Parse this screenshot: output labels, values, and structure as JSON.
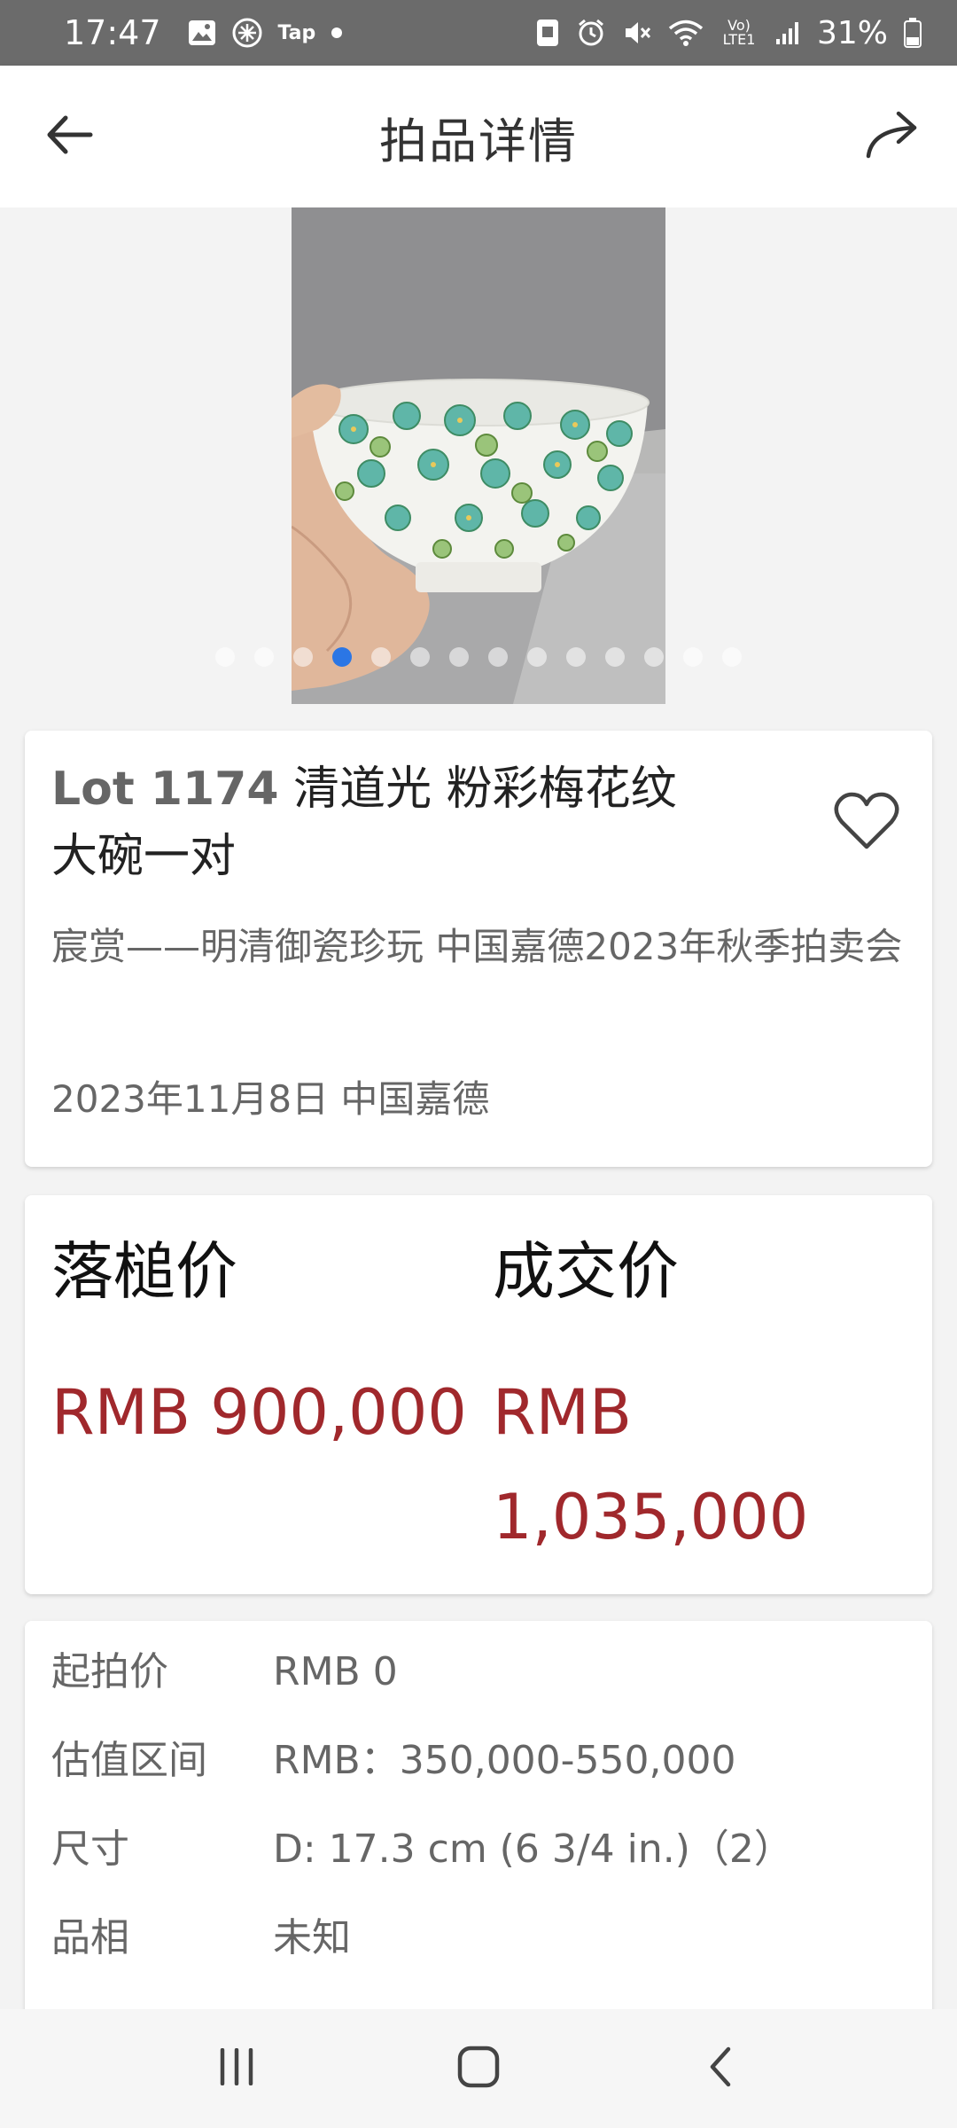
{
  "status_bar": {
    "time": "17:47",
    "tap_label": "Tap",
    "volte_label": "Vo) LTE1",
    "battery": "31%",
    "icons": [
      "image-icon",
      "metro-icon",
      "tap-icon",
      "dot-icon",
      "screenshot-icon",
      "alarm-icon",
      "mute-icon",
      "wifi-icon",
      "volte-icon",
      "signal-icon",
      "battery-icon"
    ]
  },
  "app_bar": {
    "title": "拍品详情",
    "back_icon": "arrow-left-icon",
    "share_icon": "share-arrow-icon"
  },
  "carousel": {
    "image_subject": "porcelain bowl with green plum blossom pattern held in hand",
    "dot_count": 14,
    "active_index": 3,
    "accent": "#2b76e5"
  },
  "lot": {
    "number": "Lot 1174",
    "title_line1": "清道光 粉彩梅花纹",
    "title_line2": "大碗一对",
    "sale_name": "宸赏——明清御瓷珍玩 中国嘉德2023年秋季拍卖会",
    "date_house": "2023年11月8日 中国嘉德",
    "favorite_icon": "heart-outline-icon"
  },
  "prices": {
    "hammer_label": "落槌价",
    "hammer_value": "RMB 900,000",
    "deal_label": "成交价",
    "deal_value": "RMB 1,035,000",
    "price_color": "#a0282c"
  },
  "details": [
    {
      "key": "起拍价",
      "value": "RMB 0"
    },
    {
      "key": "估值区间",
      "value": "RMB：350,000-550,000"
    },
    {
      "key": "尺寸",
      "value": "D: 17.3 cm (6 3/4 in.)（2）"
    },
    {
      "key": "品相",
      "value": "未知"
    }
  ],
  "nav_bar": {
    "icons": [
      "recent-apps-icon",
      "home-icon",
      "back-icon"
    ]
  }
}
